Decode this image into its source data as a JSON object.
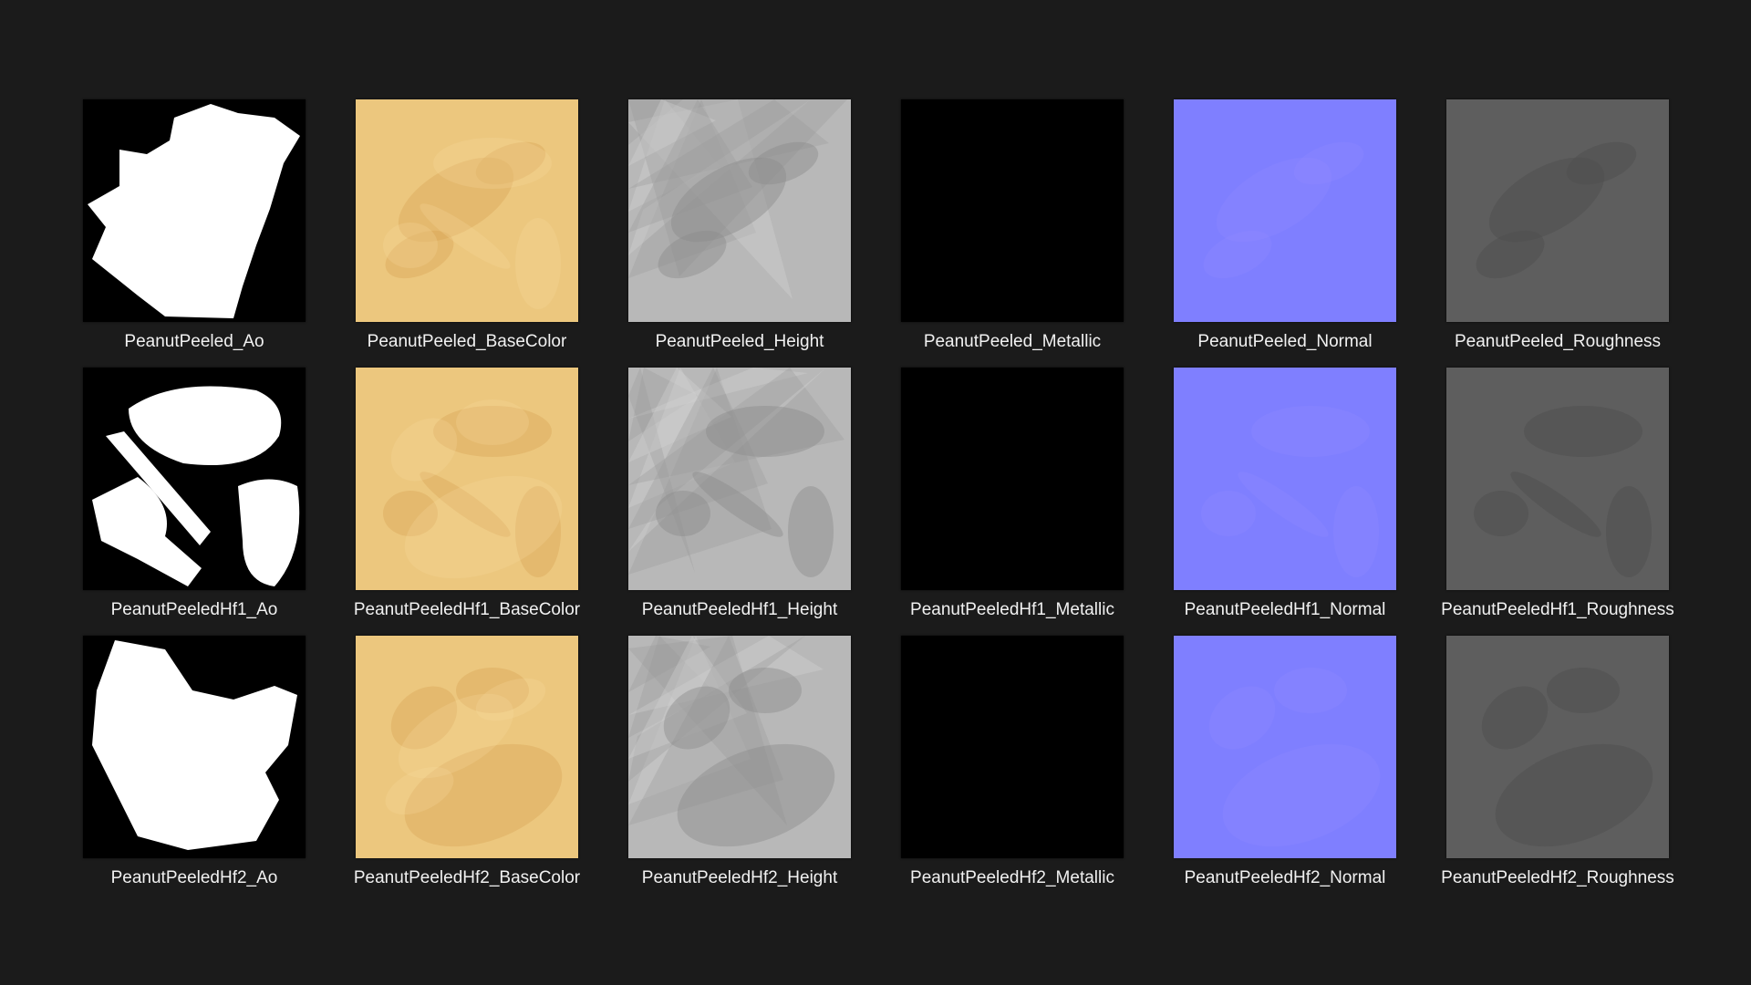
{
  "textures": [
    {
      "label": "PeanutPeeled_Ao",
      "map": "ao",
      "variant": 0
    },
    {
      "label": "PeanutPeeled_BaseColor",
      "map": "basecolor",
      "variant": 0
    },
    {
      "label": "PeanutPeeled_Height",
      "map": "height",
      "variant": 0
    },
    {
      "label": "PeanutPeeled_Metallic",
      "map": "metallic",
      "variant": 0
    },
    {
      "label": "PeanutPeeled_Normal",
      "map": "normal",
      "variant": 0
    },
    {
      "label": "PeanutPeeled_Roughness",
      "map": "roughness",
      "variant": 0
    },
    {
      "label": "PeanutPeeledHf1_Ao",
      "map": "ao",
      "variant": 1
    },
    {
      "label": "PeanutPeeledHf1_BaseColor",
      "map": "basecolor",
      "variant": 1
    },
    {
      "label": "PeanutPeeledHf1_Height",
      "map": "height",
      "variant": 1
    },
    {
      "label": "PeanutPeeledHf1_Metallic",
      "map": "metallic",
      "variant": 1
    },
    {
      "label": "PeanutPeeledHf1_Normal",
      "map": "normal",
      "variant": 1
    },
    {
      "label": "PeanutPeeledHf1_Roughness",
      "map": "roughness",
      "variant": 1
    },
    {
      "label": "PeanutPeeledHf2_Ao",
      "map": "ao",
      "variant": 2
    },
    {
      "label": "PeanutPeeledHf2_BaseColor",
      "map": "basecolor",
      "variant": 2
    },
    {
      "label": "PeanutPeeledHf2_Height",
      "map": "height",
      "variant": 2
    },
    {
      "label": "PeanutPeeledHf2_Metallic",
      "map": "metallic",
      "variant": 2
    },
    {
      "label": "PeanutPeeledHf2_Normal",
      "map": "normal",
      "variant": 2
    },
    {
      "label": "PeanutPeeledHf2_Roughness",
      "map": "roughness",
      "variant": 2
    }
  ],
  "colors": {
    "background": "#1b1b1b",
    "label_text": "#f1f1f1",
    "ao_background": "#000000",
    "ao_shape": "#ffffff",
    "basecolor": "#ecc77e",
    "height": "#b8b8b8",
    "metallic": "#000000",
    "normal": "#7f7fff",
    "roughness": "#5e5e5e"
  }
}
